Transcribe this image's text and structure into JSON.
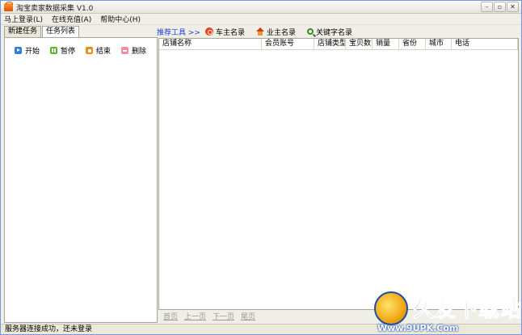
{
  "window": {
    "title": "淘宝卖家数据采集 V1.0",
    "controls": {
      "minimize": "–",
      "maximize": "▫",
      "close": "✕"
    }
  },
  "menu": {
    "items": [
      "马上登录(L)",
      "在线充值(A)",
      "帮助中心(H)"
    ]
  },
  "tabs": {
    "items": [
      {
        "label": "新建任务",
        "active": false
      },
      {
        "label": "任务列表",
        "active": true
      }
    ]
  },
  "task_actions": {
    "start": "开始",
    "pause": "暂停",
    "stop": "结束",
    "delete": "删除"
  },
  "toolbar": {
    "label": "推荐工具 >>",
    "items": [
      {
        "label": "车主名录",
        "icon": "car-icon"
      },
      {
        "label": "业主名录",
        "icon": "house-icon"
      },
      {
        "label": "关键字名录",
        "icon": "search-icon"
      }
    ]
  },
  "table": {
    "columns": [
      "店铺名称",
      "会员账号",
      "店铺类型",
      "宝贝数",
      "销量",
      "省份",
      "城市",
      "电话"
    ]
  },
  "pager": {
    "first": "首页",
    "prev": "上一页",
    "next": "下一页",
    "last": "尾页"
  },
  "status": {
    "text": "服务器连接成功，还未登录"
  },
  "watermark": {
    "brand": "久友下载站",
    "url": "Www.9UPK.Com"
  }
}
